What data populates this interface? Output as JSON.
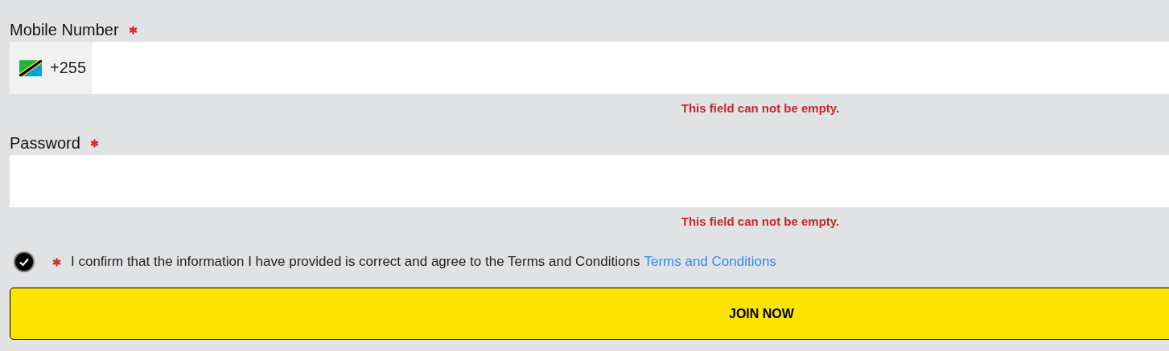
{
  "fields": [
    {
      "kind": "phone",
      "label": "Mobile Number",
      "required": true,
      "prefix": "+255",
      "error": "This field can not be empty."
    },
    {
      "kind": "password",
      "label": "Password",
      "required": true,
      "error": "This field can not be empty."
    }
  ],
  "consent": {
    "checked": true,
    "required": true,
    "text": "I confirm that the information I have provided is correct and agree to the Terms and Conditions",
    "link": "Terms and Conditions"
  },
  "submit": "JOIN NOW"
}
